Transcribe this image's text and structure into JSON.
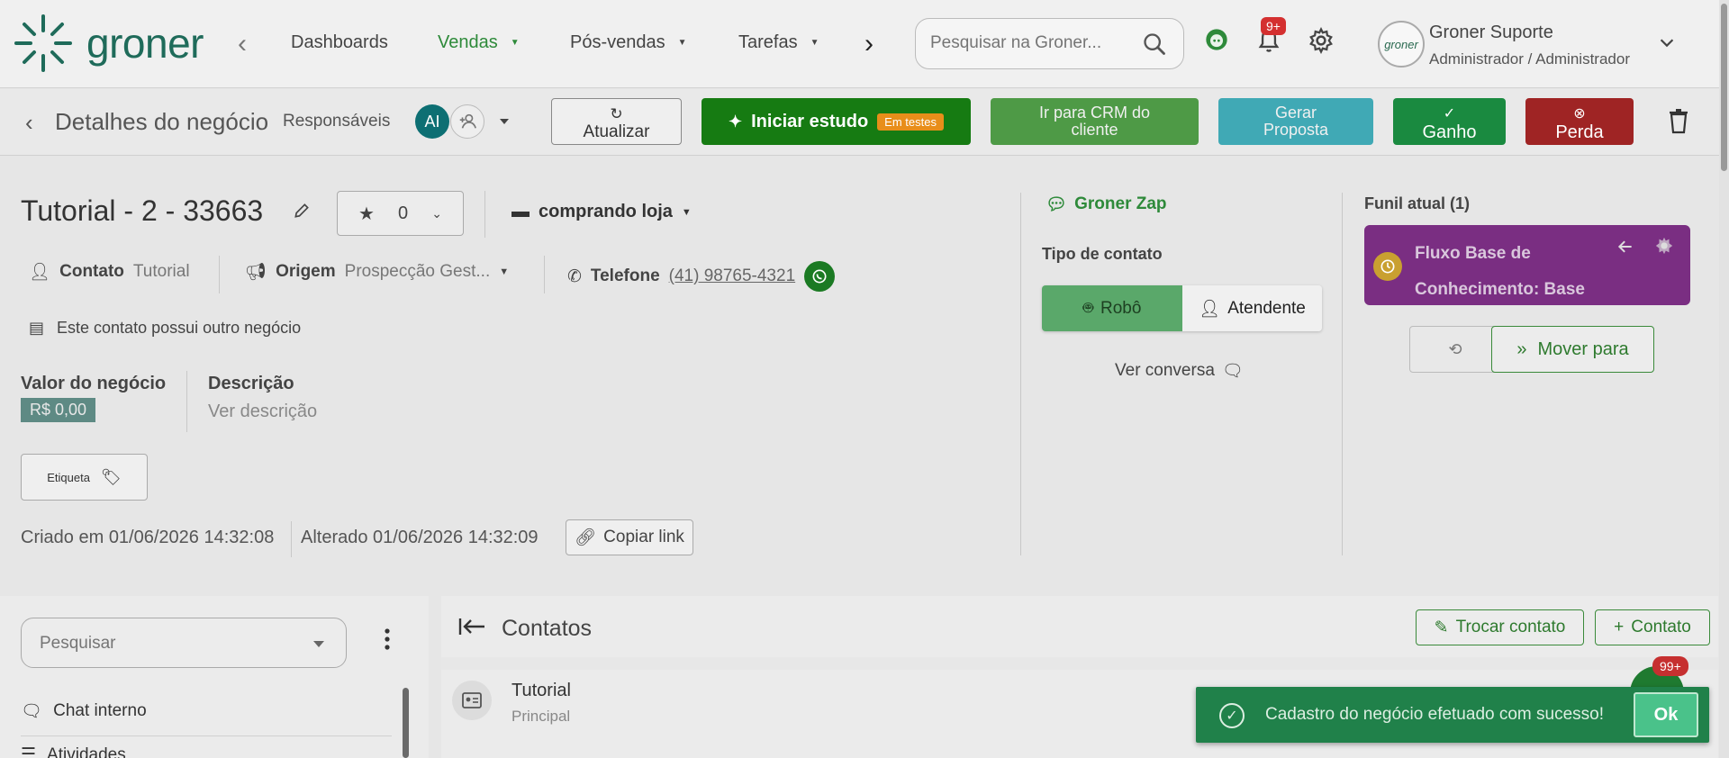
{
  "brand": {
    "name": "groner",
    "color": "#1f6b5a"
  },
  "nav": {
    "items": [
      {
        "label": "Dashboards",
        "active": false,
        "dropdown": false
      },
      {
        "label": "Vendas",
        "active": true,
        "dropdown": true
      },
      {
        "label": "Pós-vendas",
        "active": false,
        "dropdown": true
      },
      {
        "label": "Tarefas",
        "active": false,
        "dropdown": true
      }
    ],
    "search_placeholder": "Pesquisar na Groner...",
    "notifications_badge": "9+",
    "user": {
      "name": "Groner Suporte",
      "role": "Administrador / Administrador",
      "avatar_text": "groner"
    }
  },
  "actionbar": {
    "title": "Detalhes do negócio",
    "responsaveis_label": "Responsáveis",
    "avatar_initials": "AI",
    "buttons": {
      "refresh": "Atualizar",
      "study": "Iniciar estudo",
      "study_badge": "Em testes",
      "crm": "Ir para CRM do cliente",
      "proposal": "Gerar Proposta",
      "won": "Ganho",
      "lost": "Perda"
    }
  },
  "deal": {
    "title": "Tutorial - 2 - 33663",
    "stars": "0",
    "store": "comprando loja",
    "contact_label": "Contato",
    "contact_value": "Tutorial",
    "origin_label": "Origem",
    "origin_value": "Prospecção Gest...",
    "phone_label": "Telefone",
    "phone_value": "(41) 98765-4321",
    "other_deal_note": "Este contato possui outro negócio",
    "value_label": "Valor do negócio",
    "value": "R$ 0,00",
    "description_label": "Descrição",
    "description_link": "Ver descrição",
    "tag_button": "Etiqueta",
    "created": "Criado em 01/06/2026 14:32:08",
    "updated": "Alterado 01/06/2026 14:32:09",
    "copy_link": "Copiar link"
  },
  "zap": {
    "title": "Groner Zap",
    "contact_type_label": "Tipo de contato",
    "robot": "Robô",
    "attendant": "Atendente",
    "view_conversation": "Ver conversa"
  },
  "funnel": {
    "title": "Funil atual (1)",
    "card_line1": "Fluxo Base de",
    "card_line2": "Conhecimento: Base",
    "move_button": "Mover para",
    "color": "#7a2e82"
  },
  "left_panel": {
    "search_placeholder": "Pesquisar",
    "items": [
      "Chat interno",
      "Atividades"
    ]
  },
  "contacts": {
    "title": "Contatos",
    "swap_button": "Trocar contato",
    "add_button": "Contato",
    "rows": [
      {
        "name": "Tutorial",
        "sub": "Principal"
      }
    ]
  },
  "fab_badge": "99+",
  "toast": {
    "message": "Cadastro do negócio efetuado com sucesso!",
    "ok": "Ok"
  },
  "colors": {
    "accent": "#2e8a3a",
    "won": "#1a8a40",
    "lost": "#9f2424",
    "study": "#167b12"
  }
}
